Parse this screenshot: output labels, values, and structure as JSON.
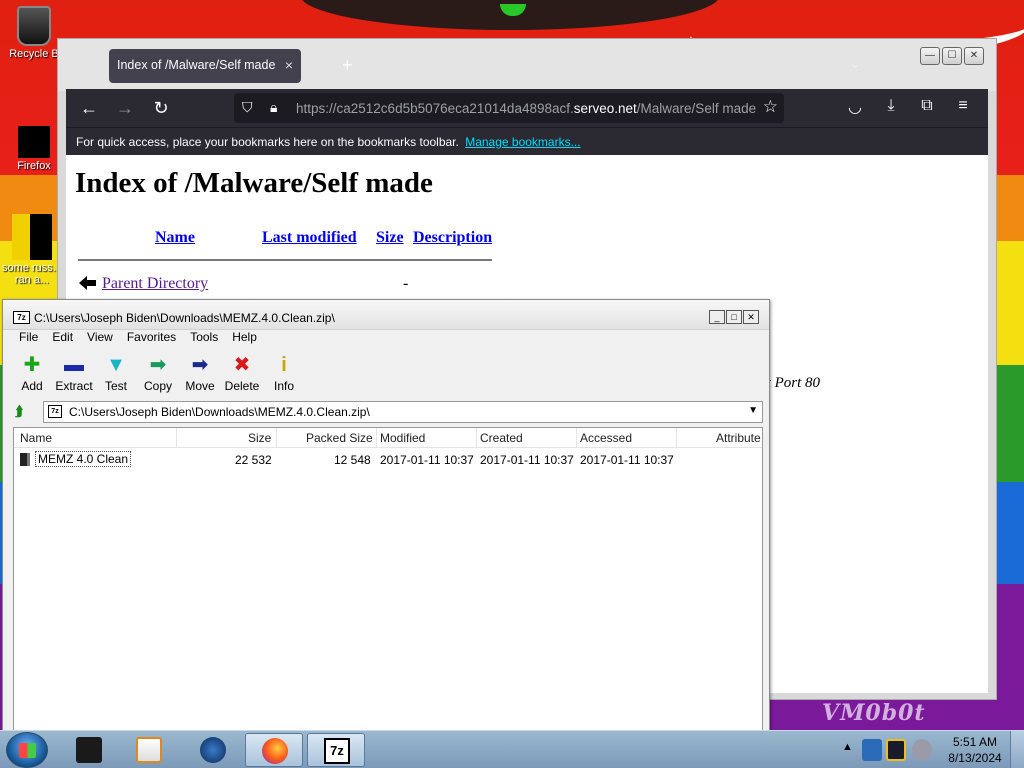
{
  "desktop": {
    "icons": [
      {
        "label": "Recycle B"
      },
      {
        "label": "Firefox"
      },
      {
        "label": "some russ... ran a..."
      }
    ],
    "watermark": "VM0b0t"
  },
  "browser": {
    "tab_title": "Index of /Malware/Self made",
    "tab_close": "×",
    "new_tab": "+",
    "url_prefix": "https://ca2512c6d5b5076eca21014da4898acf.",
    "url_host": "serveo.net",
    "url_path": "/Malware/Self made",
    "bookmarks_hint": "For quick access, place your bookmarks here on the bookmarks toolbar.",
    "bookmarks_link": "Manage bookmarks...",
    "page": {
      "heading": "Index of /Malware/Self made",
      "columns": {
        "name": "Name",
        "last_modified": "Last modified",
        "size": "Size",
        "description": "Description"
      },
      "parent_link": "Parent Directory",
      "parent_size": "-",
      "address_tail": "et Port 80"
    }
  },
  "sevenzip": {
    "title_icon": "7z",
    "title": "C:\\Users\\Joseph Biden\\Downloads\\MEMZ.4.0.Clean.zip\\",
    "menu": [
      "File",
      "Edit",
      "View",
      "Favorites",
      "Tools",
      "Help"
    ],
    "toolbar": [
      {
        "label": "Add",
        "glyph": "✚",
        "color": "#1aa41a"
      },
      {
        "label": "Extract",
        "glyph": "▬",
        "color": "#1a2aa8"
      },
      {
        "label": "Test",
        "glyph": "▼",
        "color": "#1ab4c8"
      },
      {
        "label": "Copy",
        "glyph": "➡",
        "color": "#1a9a5a"
      },
      {
        "label": "Move",
        "glyph": "➡",
        "color": "#1a2a8a"
      },
      {
        "label": "Delete",
        "glyph": "✖",
        "color": "#d81a1a"
      },
      {
        "label": "Info",
        "glyph": "i",
        "color": "#c8a800"
      }
    ],
    "address": "C:\\Users\\Joseph Biden\\Downloads\\MEMZ.4.0.Clean.zip\\",
    "columns": [
      "Name",
      "Size",
      "Packed Size",
      "Modified",
      "Created",
      "Accessed",
      "Attribute"
    ],
    "rows": [
      {
        "name": "MEMZ 4.0 Clean",
        "size": "22 532",
        "packed": "12 548",
        "modified": "2017-01-11 10:37",
        "created": "2017-01-11 10:37",
        "accessed": "2017-01-11 10:37",
        "attributes": ""
      }
    ]
  },
  "taskbar": {
    "tray_expand": "▲",
    "time": "5:51 AM",
    "date": "8/13/2024"
  }
}
